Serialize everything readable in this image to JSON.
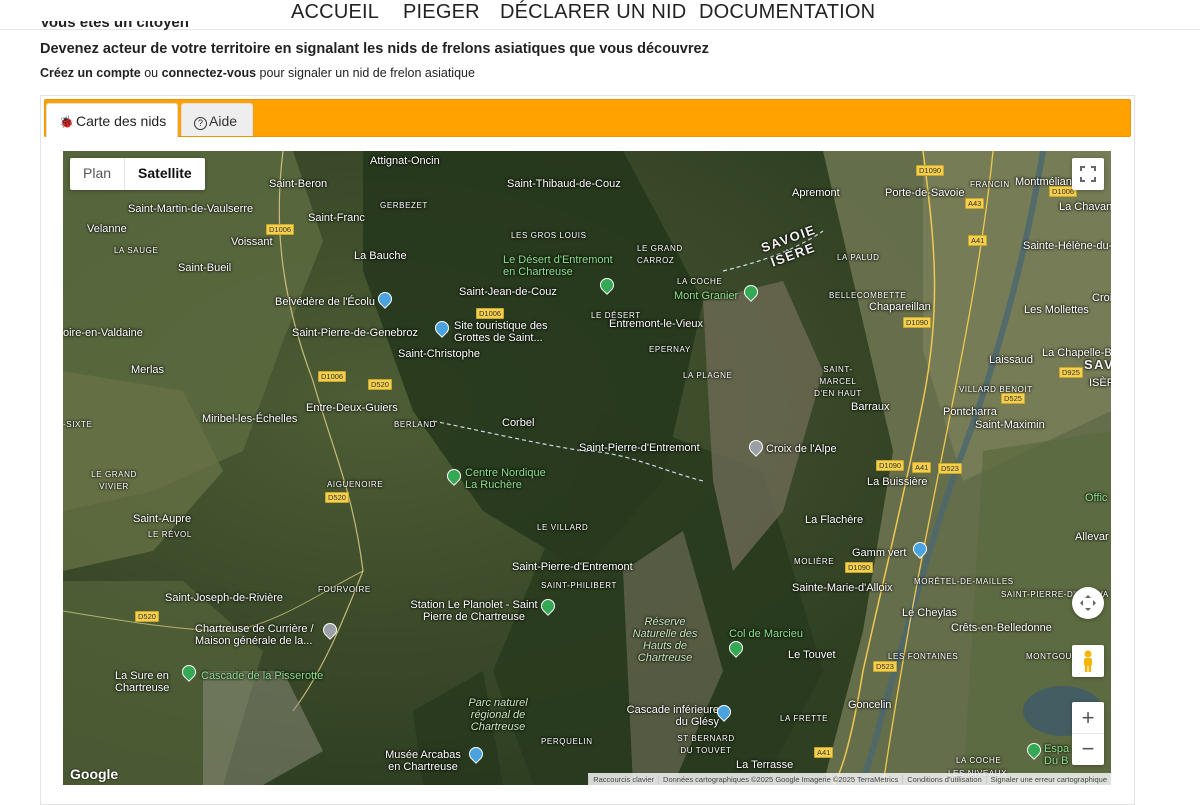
{
  "nav": {
    "items": [
      "ACCUEIL",
      "PIEGER",
      "DÉCLARER UN NID",
      "DOCUMENTATION"
    ]
  },
  "intro": {
    "partial_heading": "Vous êtes un citoyen",
    "headline": "Devenez acteur de votre territoire en signalant les nids de frelons asiatiques que vous découvrez",
    "create_account": "Créez un compte",
    "or": " ou ",
    "login": "connectez-vous",
    "rest": " pour signaler un nid de frelon asiatique"
  },
  "tabs": {
    "map_tab": "Carte des nids",
    "help_tab": "Aide"
  },
  "colors": {
    "tabbar": "#ffa200",
    "pin_green": "#34a853",
    "pin_blue": "#4aa3df"
  },
  "map": {
    "type_plan": "Plan",
    "type_satellite": "Satellite",
    "zoom_in": "+",
    "zoom_out": "−",
    "google": "Google",
    "attribution": {
      "shortcuts": "Raccourcis clavier",
      "data": "Données cartographiques ©2025 Google Imagerie ©2025 TerraMetrics",
      "terms": "Conditions d'utilisation",
      "report": "Signaler une erreur cartographique"
    },
    "places": [
      "Attignat-Oncin",
      "Saint-Beron",
      "Saint-Thibaud-de-Couz",
      "Apremont",
      "Porte-de-Savoie",
      "FRANCIN",
      "Montmélian",
      "Saint-Martin-de-Vaulserre",
      "GERBEZET",
      "Saint-Franc",
      "La Chavan",
      "Velanne",
      "Voissant",
      "LES GROS LOUIS",
      "LA SAUGE",
      "La Bauche",
      "Le Désert d'Entremont en Chartreuse",
      "LE GRAND CARROZ",
      "SAVOIE",
      "ISÈRE",
      "LA PALUD",
      "Sainte-Hélène-du-",
      "Saint-Bueil",
      "LA COCHE",
      "Mont Granier",
      "BELLECOMBETTE",
      "Saint-Jean-de-Couz",
      "Belvédère de l'Écolu",
      "Chapareillan",
      "Croi",
      "LE DÉSERT",
      "Les Mollettes",
      "oire-en-Valdaine",
      "Saint-Pierre-de-Genebroz",
      "Site touristique des Grottes de Saint...",
      "Entremont-le-Vieux",
      "EPERNAY",
      "Saint-Christophe",
      "Laissaud",
      "La Chapelle-Bl",
      "Merlas",
      "LA PLAGNE",
      "SAINT-MARCEL D'EN HAUT",
      "SAVO",
      "VILLARD BENOIT",
      "ISÈR",
      "Entre-Deux-Guiers",
      "Barraux",
      "Pontcharra",
      "Miribel-les-Échelles",
      "BERLAND",
      "Corbel",
      "Saint-Maximin",
      "-SIXTE",
      "Saint-Pierre-d'Entremont",
      "Croix de l'Alpe",
      "LE GRAND VIVIER",
      "AIGUENOIRE",
      "Centre Nordique La Ruchère",
      "La Buissière",
      "Offic",
      "Saint-Aupre",
      "LE VILLARD",
      "La Flachère",
      "LE RÉVOL",
      "Gamm vert",
      "Allevar",
      "MOLIÈRE",
      "Saint-Pierre-d'Entremont",
      "SAINT-PHILIBERT",
      "FOURVOIRE",
      "MORÊTEL-DE-MAILLES",
      "Sainte-Marie-d'Alloix",
      "SAINT-PIERRE-D'ALLEVA",
      "Saint-Joseph-de-Rivière",
      "Station Le Planolet - Saint Pierre de Chartreuse",
      "Le Cheylas",
      "Crêts-en-Belledonne",
      "Chartreuse de Currière / Maison générale de la...",
      "Réserve Naturelle des Hauts de Chartreuse",
      "Col de Marcieu",
      "Le Touvet",
      "LES FONTAINES",
      "MONTGOUTO",
      "La Sure en Chartreuse",
      "Cascade de la Pisserotte",
      "Parc naturel régional de Chartreuse",
      "Goncelin",
      "Cascade inférieure du Glésy",
      "LA FRETTE",
      "ST BERNARD DU TOUVET",
      "PERQUELIN",
      "Musée Arcabas en Chartreuse",
      "La Terrasse",
      "LA COCHE",
      "LES NIVEAUX",
      "Espa Du B"
    ],
    "roads": [
      "D1006",
      "D1090",
      "D1006",
      "D1006",
      "D520",
      "D1006",
      "D520",
      "D520",
      "D1090",
      "A41",
      "D523",
      "D1090",
      "D523",
      "D1090",
      "A41",
      "A43",
      "A41",
      "D925",
      "D525"
    ]
  }
}
